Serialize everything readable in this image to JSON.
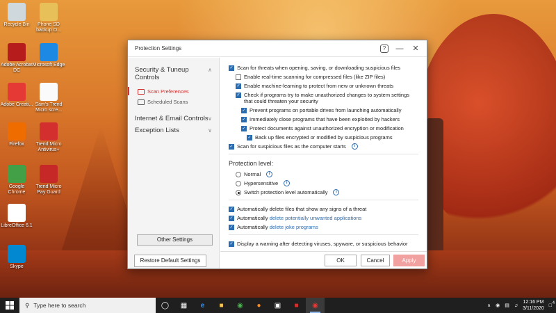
{
  "desktop": {
    "icons": [
      {
        "label": "Recycle Bin",
        "icon": "recycle-bin-icon",
        "color": "#cfd8dc"
      },
      {
        "label": "Phone SD backup O...",
        "icon": "folder-icon",
        "color": "#e8c05a"
      },
      {
        "label": "Adobe Acrobat DC",
        "icon": "acrobat-icon",
        "color": "#b71c1c"
      },
      {
        "label": "Microsoft Edge",
        "icon": "edge-icon",
        "color": "#1e88e5"
      },
      {
        "label": "Adobe Creati...",
        "icon": "creative-cloud-icon",
        "color": "#e53935"
      },
      {
        "label": "Sam's Trend Micro scre...",
        "icon": "document-icon",
        "color": "#fafafa"
      },
      {
        "label": "Firefox",
        "icon": "firefox-icon",
        "color": "#ef6c00"
      },
      {
        "label": "Trend Micro Antivirus+",
        "icon": "trend-micro-icon",
        "color": "#d32f2f"
      },
      {
        "label": "Google Chrome",
        "icon": "chrome-icon",
        "color": "#43a047"
      },
      {
        "label": "Trend Micro Pay Guard",
        "icon": "pay-guard-icon",
        "color": "#c62828"
      },
      {
        "label": "LibreOffice 6.1",
        "icon": "libreoffice-icon",
        "color": "#ffffff"
      },
      {
        "label": "Skype",
        "icon": "skype-icon",
        "color": "#0288d1"
      }
    ]
  },
  "dialog": {
    "title": "Protection Settings",
    "help_label": "?",
    "nav": {
      "security_tuneup": "Security & Tuneup Controls",
      "scan_preferences": "Scan Preferences",
      "scheduled_scans": "Scheduled Scans",
      "internet_email": "Internet & Email Controls",
      "exception_lists": "Exception Lists"
    },
    "other_settings": "Other Settings",
    "restore_defaults": "Restore Default Settings",
    "options": {
      "scan_threats": "Scan for threats when opening, saving, or downloading suspicious files",
      "realtime_compressed": "Enable real-time scanning for compressed files (like ZIP files)",
      "machine_learning": "Enable machine-learning to protect from new or unknown threats",
      "check_programs": "Check if programs try to make unauthorized changes to system settings that could threaten your security",
      "prevent_portable": "Prevent programs on portable drives from launching automatically",
      "close_exploited": "Immediately close programs that have been exploited by hackers",
      "protect_documents": "Protect documents against unauthorized encryption or modification",
      "backup_files": "Back up files encrypted or modified by suspicious programs",
      "scan_startup": "Scan for suspicious files as the computer starts"
    },
    "protection": {
      "label": "Protection level:",
      "normal": "Normal",
      "hypersensitive": "Hypersensitive",
      "auto": "Switch protection level automatically"
    },
    "auto_delete": {
      "threats": "Automatically delete files that show any signs of a threat",
      "pua_prefix": "Automatically ",
      "pua_link": "delete potentially unwanted applications",
      "joke_prefix": "Automatically ",
      "joke_link": "delete joke programs"
    },
    "display_warning": "Display a warning after detecting viruses, spyware, or suspicious behavior",
    "ok": "OK",
    "cancel": "Cancel",
    "apply": "Apply",
    "accent_color": "#d2302f",
    "link_color": "#2b6cb0"
  },
  "taskbar": {
    "search_placeholder": "Type here to search",
    "time": "12:16 PM",
    "date": "3/11/2020",
    "notification_count": "4"
  }
}
